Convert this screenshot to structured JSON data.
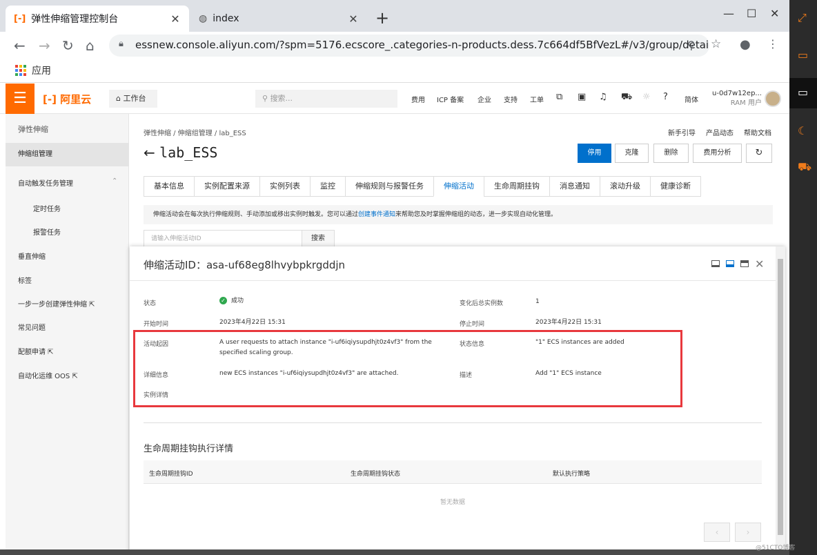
{
  "browser": {
    "tab1_title": "弹性伸缩管理控制台",
    "tab2_title": "index",
    "url": "essnew.console.aliyun.com/?spm=5176.ecscore_.categories-n-products.dess.7c664df5BfVezL#/v3/group/detail/⋯",
    "bookmark_apps": "应用"
  },
  "topbar": {
    "logo": "阿里云",
    "workbench": "⌂ 工作台",
    "search_placeholder": "搜索...",
    "nav": [
      "费用",
      "ICP 备案",
      "企业",
      "支持",
      "工单",
      "简体"
    ],
    "user_name": "u-0d7w12ep...",
    "user_role": "RAM 用户"
  },
  "sidebar": {
    "items": [
      "弹性伸缩",
      "伸缩组管理",
      "自动触发任务管理",
      "定时任务",
      "报警任务",
      "垂直伸缩",
      "标签",
      "一步一步创建弹性伸缩 ⇱",
      "常见问题",
      "配额申请 ⇱",
      "自动化运维 OOS ⇱"
    ]
  },
  "page": {
    "breadcrumb": "弹性伸缩 / 伸缩组管理 / lab_ESS",
    "help_links": [
      "新手引导",
      "产品动态",
      "帮助文档"
    ],
    "title": "lab_ESS",
    "actions": [
      "停用",
      "克隆",
      "删除",
      "费用分析",
      "↻"
    ],
    "tabs": [
      "基本信息",
      "实例配置来源",
      "实例列表",
      "监控",
      "伸缩规则与报警任务",
      "伸缩活动",
      "生命周期挂钩",
      "消息通知",
      "滚动升级",
      "健康诊断"
    ],
    "notice_before": "伸缩活动会在每次执行伸缩规则、手动添加或移出实例时触发。您可以通过",
    "notice_link": "创建事件通知",
    "notice_after": "来帮助您及时掌握伸缩组的动态，进一步实现自动化管理。",
    "search_placeholder": "请输入伸缩活动ID",
    "search_button": "搜索"
  },
  "dialog": {
    "title": "伸缩活动ID：asa-uf68eg8lhvybpkrgddjn",
    "fields": {
      "status_label": "状态",
      "status_value": "成功",
      "total_label": "变化后总实例数",
      "total_value": "1",
      "start_label": "开始时间",
      "start_value": "2023年4月22日 15:31",
      "stop_label": "停止时间",
      "stop_value": "2023年4月22日 15:31",
      "cause_label": "活动起因",
      "cause_value": "A user requests to attach instance \"i-uf6iqiysupdhjt0z4vf3\" from the specified scaling group.",
      "statusinfo_label": "状态信息",
      "statusinfo_value": "\"1\" ECS instances are added",
      "detail_label": "详细信息",
      "detail_value": "new ECS instances \"i-uf6iqiysupdhjt0z4vf3\" are attached.",
      "desc_label": "描述",
      "desc_value": "Add \"1\" ECS instance",
      "instance_label": "实例详情"
    },
    "lifecycle": {
      "title": "生命周期挂钩执行详情",
      "columns": [
        "生命周期挂钩ID",
        "生命周期挂钩状态",
        "默认执行策略"
      ],
      "empty": "暂无数据"
    }
  },
  "watermark": "@51CTO博客",
  "colors": {
    "brand": "#ff6a00",
    "primary": "#0070cc",
    "highlight": "#e8383d",
    "success": "#2fa84f"
  }
}
